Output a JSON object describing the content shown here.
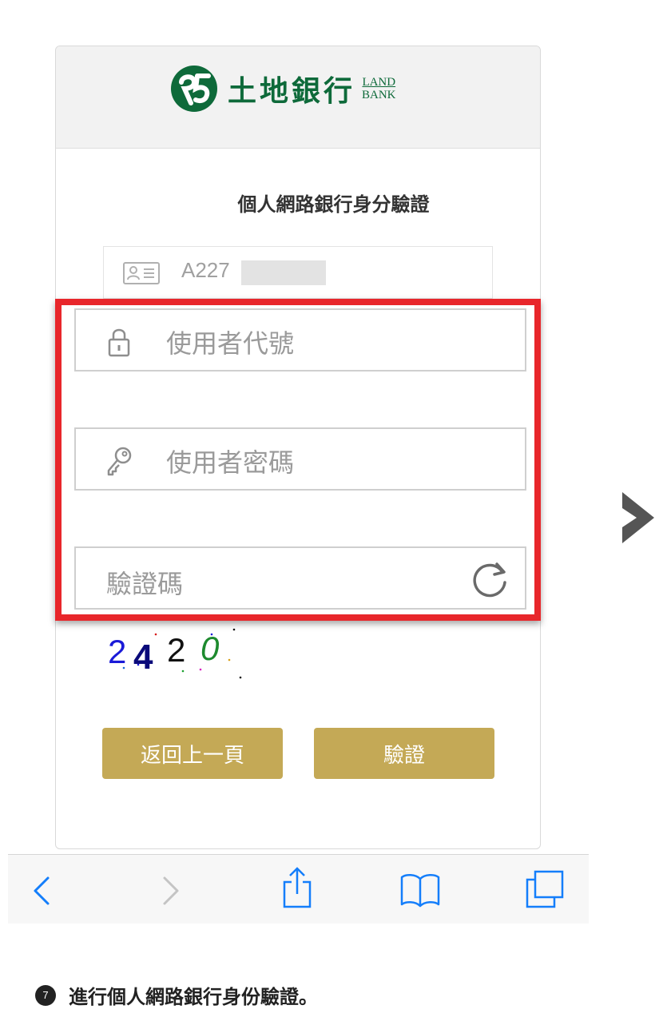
{
  "header": {
    "logo_text": "土地銀行",
    "logo_en_line1": "LAND",
    "logo_en_line2": "BANK",
    "brand_color": "#0e6a3a"
  },
  "page_title": "個人網路銀行身分驗證",
  "id_field": {
    "value": "A227"
  },
  "user_id_field": {
    "placeholder": "使用者代號",
    "icon": "lock-icon"
  },
  "password_field": {
    "placeholder": "使用者密碼",
    "icon": "key-icon"
  },
  "captcha_field": {
    "placeholder": "驗證碼",
    "icon": "refresh-icon"
  },
  "captcha_image": {
    "chars": [
      "2",
      "4",
      "2",
      "0"
    ]
  },
  "buttons": {
    "back": "返回上一頁",
    "verify": "驗證",
    "accent_color": "#c4a956"
  },
  "highlight_color": "#e8262b",
  "toolbar": {
    "items": [
      "back-icon",
      "forward-icon",
      "share-icon",
      "bookmarks-icon",
      "tabs-icon"
    ]
  },
  "caption": {
    "step": "7",
    "text": "進行個人網路銀行身份驗證。"
  }
}
